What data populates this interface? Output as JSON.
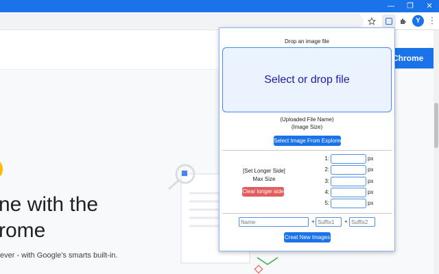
{
  "window": {
    "minimize_glyph": "—",
    "maximize_glyph": "❐",
    "close_glyph": "✕",
    "accent_color": "#1a73e8"
  },
  "toolbar": {
    "star_icon": "star-icon",
    "puzzle_glyph": "✱",
    "avatar_letter": "Y",
    "menu_glyph": "⋮"
  },
  "page": {
    "cta_label": "Chrome",
    "hero_line1": "ne with the",
    "hero_line2": "rome",
    "hero_sub": "ever - with Google's smarts built-in."
  },
  "popup": {
    "title": "Drop an image file",
    "dropzone_label": "Select or drop file",
    "uploaded_name": "(Uploaded File Name)",
    "image_size": "(Image Size)",
    "select_button": "Select Image From Explorer",
    "set_longer_side": "[Set Longer Side]",
    "max_size": "Max Size",
    "clear_button": "Clear longer side",
    "sizes": [
      {
        "label": "1:",
        "unit": "px",
        "value": ""
      },
      {
        "label": "2:",
        "unit": "px",
        "value": ""
      },
      {
        "label": "3:",
        "unit": "px",
        "value": ""
      },
      {
        "label": "4:",
        "unit": "px",
        "value": ""
      },
      {
        "label": "5:",
        "unit": "px",
        "value": ""
      }
    ],
    "name_placeholder": "Name",
    "suffix1_placeholder": "Suffix1",
    "suffix2_placeholder": "Suffix2",
    "plus": "+",
    "create_button": "Creat New Images",
    "colors": {
      "primary": "#1a73e8",
      "danger": "#e35d5d",
      "dropzone_bg": "#eaf3ff",
      "dropzone_text": "#1a1aa6"
    }
  }
}
